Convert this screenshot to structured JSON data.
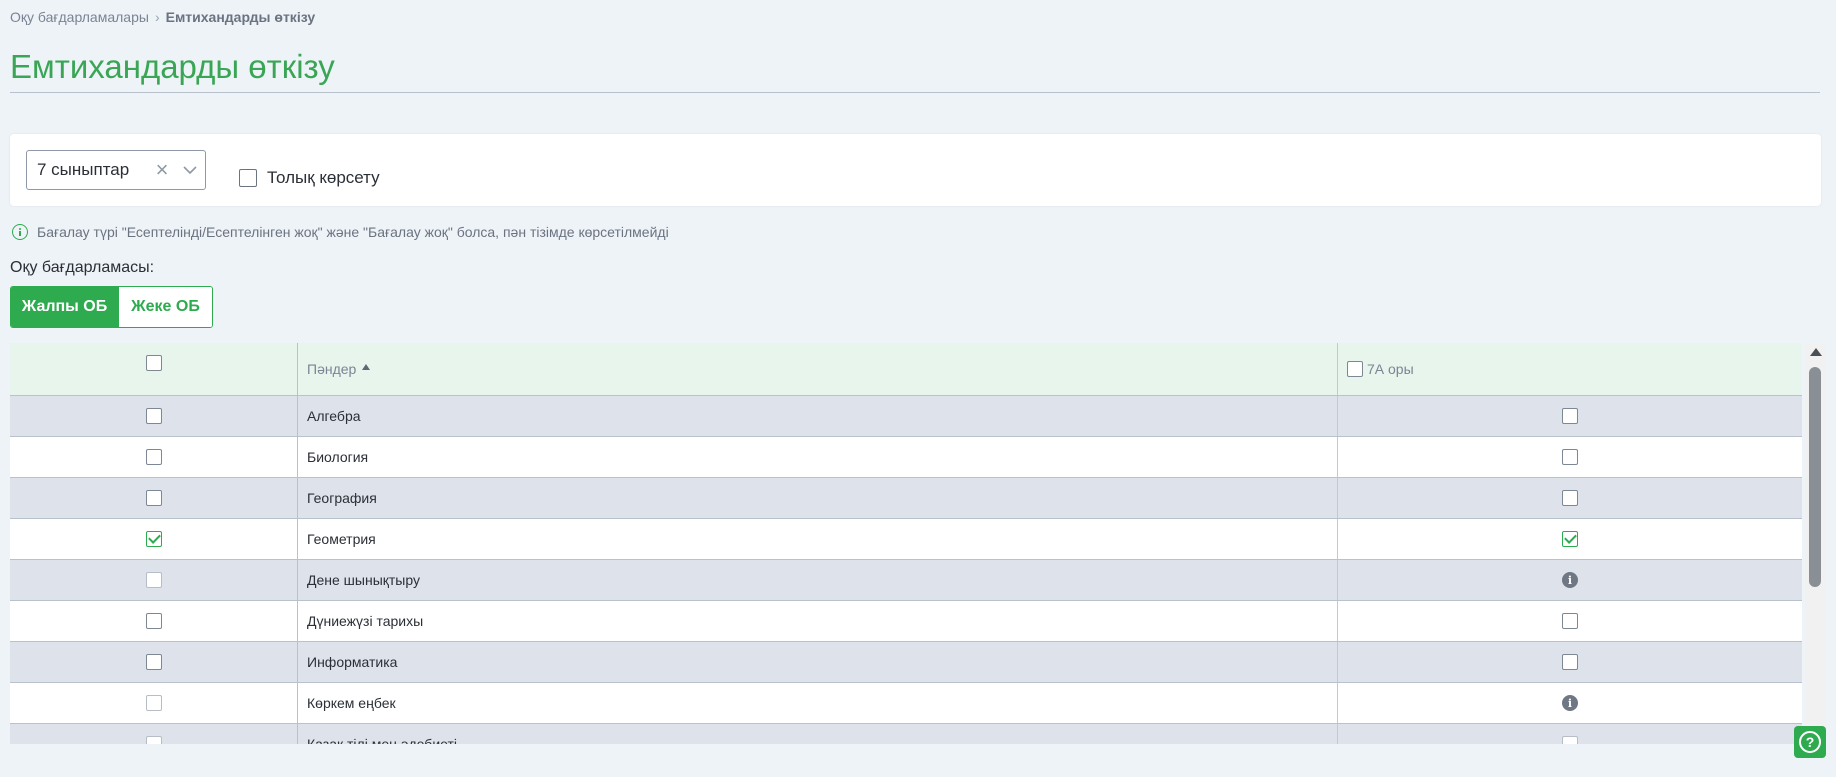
{
  "breadcrumb": {
    "parent": "Оқу бағдарламалары",
    "current": "Емтихандарды өткізу"
  },
  "page": {
    "title": "Емтихандарды өткізу"
  },
  "filter": {
    "select_value": "7 сыныптар",
    "show_all_label": "Толық көрсету",
    "show_all_checked": false
  },
  "info": {
    "text": "Бағалау түрі \"Есептелінді/Есептелінген жоқ\" және \"Бағалау жоқ\" болса, пән тізімде көрсетілмейді"
  },
  "program": {
    "label": "Оқу бағдарламасы:",
    "options": [
      "Жалпы ОБ",
      "Жеке ОБ"
    ],
    "active": "Жалпы ОБ"
  },
  "table": {
    "headers": {
      "subject": "Пәндер",
      "class_col": "7А оры"
    },
    "rows": [
      {
        "subject": "Алгебра",
        "selected": "unchecked",
        "class_state": "unchecked"
      },
      {
        "subject": "Биология",
        "selected": "unchecked",
        "class_state": "unchecked"
      },
      {
        "subject": "География",
        "selected": "unchecked",
        "class_state": "unchecked"
      },
      {
        "subject": "Геометрия",
        "selected": "checked",
        "class_state": "checked"
      },
      {
        "subject": "Дене шынықтыру",
        "selected": "disabled",
        "class_state": "info"
      },
      {
        "subject": "Дүниежүзі тарихы",
        "selected": "unchecked",
        "class_state": "unchecked"
      },
      {
        "subject": "Информатика",
        "selected": "unchecked",
        "class_state": "unchecked"
      },
      {
        "subject": "Көркем еңбек",
        "selected": "disabled",
        "class_state": "info"
      },
      {
        "subject": "Қазақ тілі мен әдебиеті",
        "selected": "disabled",
        "class_state": "disabled"
      }
    ]
  },
  "colors": {
    "accent": "#2eaa4f",
    "header_bg": "#e8f5ec",
    "row_alt": "#dee2ea"
  },
  "icons": {
    "breadcrumb_sep": "chevron-right-icon",
    "clear": "close-icon",
    "dropdown": "chevron-down-icon",
    "info": "info-circle-icon",
    "help": "question-circle-icon"
  }
}
